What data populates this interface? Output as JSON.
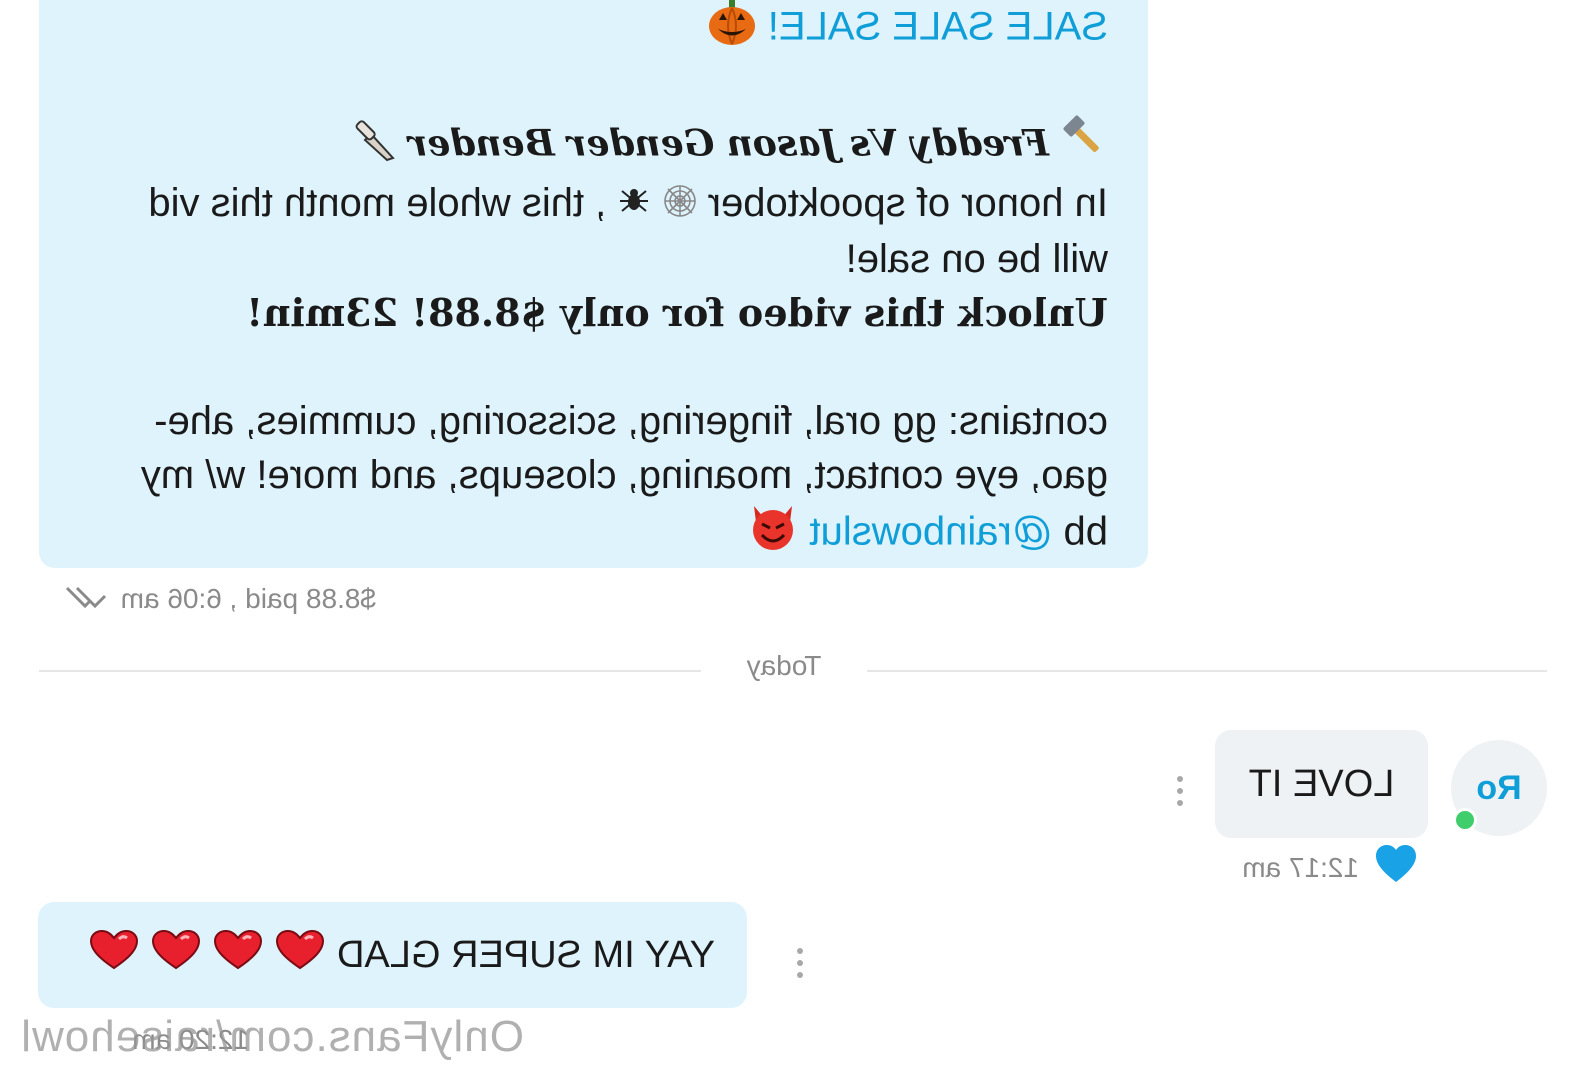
{
  "ppv_message": {
    "heading": "SALE SALE SALE!",
    "title": "Freddy Vs Jason Gender Bender",
    "desc_line1": "In honor of spooktober",
    "desc_line1b": ", this whole month this vid",
    "desc_line2": "will be on sale!",
    "unlock": "Unlock this video for only $8.88! 23min!",
    "contains_line1": "contains: gg oral, fingering, scissoring, cummies, ahe-",
    "contains_line2": "gao, eye contact, moaning, closeups, and more! w/ my",
    "contains_line3_prefix": "bb",
    "mention": "@rainbowslut"
  },
  "ppv_meta": "$8.88 paid , 6:06 am",
  "date_divider": "Today",
  "incoming": {
    "avatar_initials": "Ro",
    "text": "LOVE IT",
    "time": "12:17 am"
  },
  "reply": {
    "text": "YAY IM SUPER GLAD"
  },
  "watermark": "OnlyFans.com/raisehowl",
  "watermark_overlap_time": "12:20 am",
  "colors": {
    "accent": "#0f9ed8",
    "sent_bubble": "#def3fb",
    "recv_bubble": "#eef2f5",
    "online": "#3fce6b",
    "like": "#19a3e6"
  }
}
